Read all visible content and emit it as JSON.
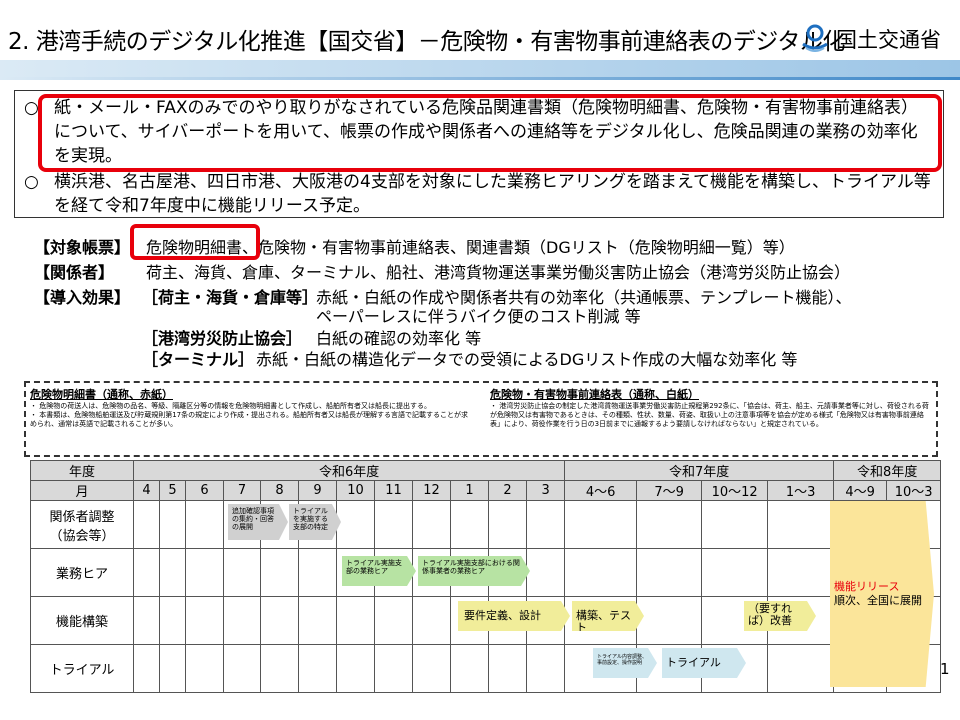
{
  "header": {
    "title": "2. 港湾手続のデジタル化推進【国交省】－危険物・有害物事前連絡表のデジタル化",
    "logo_text": "国土交通省",
    "accent": "#3f88c8"
  },
  "summary": {
    "bullets": [
      {
        "marker": "○",
        "text": "紙・メール・FAXのみでのやり取りがなされている危険品関連書類（危険物明細書、危険物・有害物事前連絡表）について、サイバーポートを用いて、帳票の作成や関係者への連絡等をデジタル化し、危険品関連の業務の効率化を実現。"
      },
      {
        "marker": "○",
        "text": "横浜港、名古屋港、四日市港、大阪港の4支部を対象にした業務ヒアリングを踏まえて機能を構築し、トライアル等を経て令和7年度中に機能リリース予定。"
      }
    ],
    "highlight_color": "#e8000b"
  },
  "info": {
    "taisho_label": "【対象帳票】",
    "taisho_value": "危険物明細書、危険物・有害物事前連絡表、関連書類（DGリスト（危険物明細一覧）等）",
    "kankei_label": "【関係者】",
    "kankei_value": "荷主、海貨、倉庫、ターミナル、船社、港湾貨物運送事業労働災害防止協会（港湾労災防止協会）",
    "effect_label": "【導入効果】",
    "effect1_head": "［荷主・海貨・倉庫等］",
    "effect1_text": "赤紙・白紙の作成や関係者共有の効率化（共通帳票、テンプレート機能）、",
    "effect1_text2": "ペーパーレスに伴うバイク便のコスト削減 等",
    "effect2_head": "［港湾労災防止協会］",
    "effect2_text": "白紙の確認の効率化 等",
    "effect3_head": "［ターミナル］",
    "effect3_text": "赤紙・白紙の構造化データでの受領によるDGリスト作成の大幅な効率化 等"
  },
  "notes": {
    "left_title": "危険物明細書（通称、赤紙）",
    "left_body": "・ 危険物の荷送人は、危険物の品名、等級、隔離区分等の情報を危険物明細書として作成し、船舶所有者又は船長に提出する。\n・ 本書類は、危険物船舶運送及び貯蔵規則第17条の規定により作成・提出される。船舶所有者又は船長が理解する言語で記載することが求められ、通常は英語で記載されることが多い。",
    "right_title": "危険物・有害物事前連絡表（通称、白紙）",
    "right_body": "・ 港湾労災防止協会の制定した港湾貨物運送事業労働災害防止規程第292条に、「協会は、荷主、船主、元請事業者等に対し、荷役される荷が危険物又は有害物であるときは、その種類、性状、数量、荷姿、取扱い上の注意事項等を協会が定める様式「危険物又は有害物事前連絡表」により、荷役作業を行う日の3日前までに通報するよう要請しなければならない」と規定されている。"
  },
  "schedule": {
    "year_label": "年度",
    "month_label": "月",
    "years": [
      "令和6年度",
      "令和7年度",
      "令和8年度"
    ],
    "months": [
      "4",
      "5",
      "6",
      "7",
      "8",
      "9",
      "10",
      "11",
      "12",
      "1",
      "2",
      "3",
      "4～6",
      "7～9",
      "10～12",
      "1～3",
      "4～9",
      "10～3"
    ],
    "rows": [
      "関係者調整\n（協会等）",
      "業務ヒア",
      "機能構築",
      "トライアル"
    ],
    "bars": {
      "b1": "追加確認事項の集約・回答の展開",
      "b2": "トライアルを実施する支部の特定",
      "b3": "トライアル実施支部の業務ヒア",
      "b4": "トライアル実施支部における関係事業者の業務ヒア",
      "b5": "要件定義、設計",
      "b6": "構築、テスト",
      "b7": "（要すれば）改善",
      "b8": "トライアル内容調整、事前設定、操作説明",
      "b9": "トライアル"
    },
    "release_label": "機能リリース",
    "release_text": "順次、全国に展開",
    "colors": {
      "gray": "#d0d0d0",
      "green": "#b7e3a3",
      "yellow": "#f1ed9a",
      "blue": "#cfe7ef",
      "release": "#fbe59a"
    }
  },
  "page_number": "1"
}
